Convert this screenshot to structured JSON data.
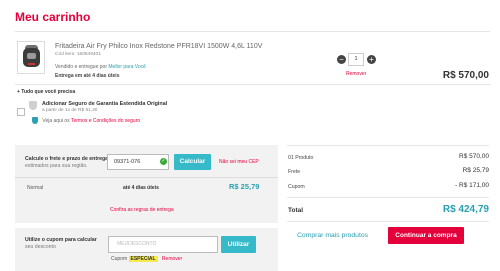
{
  "header": {
    "title": "Meu carrinho"
  },
  "product": {
    "name": "Fritadeira Air Fry Philco Inox Redstone PFR18VI 1500W 4,6L 110V",
    "code": "Cód item: 150549401",
    "seller_prefix": "Vendido e entregue por",
    "seller_name": "Mellor para Você",
    "delivery": "Entrega em até 4 dias úteis",
    "quantity": "1",
    "minus_symbol": "−",
    "plus_symbol": "+",
    "remove_label": "Remover",
    "price": "R$ 570,00"
  },
  "extras": {
    "section_title": "+ Tudo que você precisa",
    "warranty_title": "Adicionar Seguro de Garantia Estendida Original",
    "warranty_sub": "a partir de 1x de R$ 51,30",
    "terms_prefix": "Veja aqui os",
    "terms_link": "Termos e Condições do seguro"
  },
  "freight": {
    "label": "Calcule o frete e prazo de entrega",
    "sub": "estimados para sua região.",
    "cep_value": "09371-076",
    "calc_button": "Calcular",
    "no_cep": "Não sei meu CEP",
    "ship_type": "Normal",
    "ship_time": "até 4 dias úteis",
    "ship_price": "R$ 25,79",
    "rules_link": "Confira as regras de entrega"
  },
  "coupon": {
    "label": "Utilize o cupom para calcular",
    "sub": "seu desconto",
    "placeholder": "MEUDESCONTO",
    "use_button": "Utilizar",
    "applied_prefix": "Cupom",
    "applied_code": "ESPECIAL",
    "remove_label": "Remover"
  },
  "summary": {
    "products_label": "01 Produto",
    "products_value": "R$ 570,00",
    "freight_label": "Frete",
    "freight_value": "R$ 25,79",
    "coupon_label": "Cupom",
    "coupon_value": "- R$ 171,00",
    "total_label": "Total",
    "total_value": "R$ 424,79",
    "more_products": "Comprar mais produtos",
    "checkout_button": "Continuar a compra"
  },
  "icons": {
    "check": "check-circle-icon",
    "shield": "shield-icon",
    "warranty": "warranty-badge-icon"
  },
  "colors": {
    "brand_red": "#e4003b",
    "accent_teal": "#36b9c8",
    "coupon_highlight": "#f5ea4a"
  }
}
